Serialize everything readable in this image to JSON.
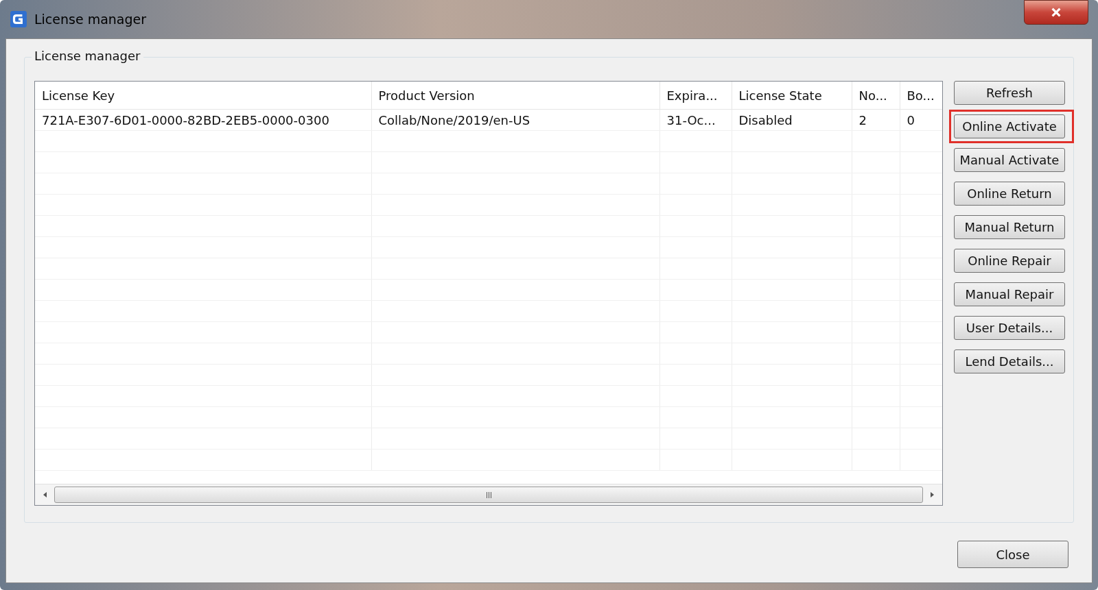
{
  "window": {
    "title": "License manager"
  },
  "group": {
    "label": "License manager"
  },
  "table": {
    "columns": [
      "License Key",
      "Product Version",
      "Expira...",
      "License State",
      "No...",
      "Bo..."
    ],
    "rows": [
      [
        "721A-E307-6D01-0000-82BD-2EB5-0000-0300",
        "Collab/None/2019/en-US",
        "31-Oc...",
        "Disabled",
        "2",
        "0"
      ]
    ]
  },
  "buttons": [
    {
      "label": "Refresh",
      "highlighted": false
    },
    {
      "label": "Online Activate",
      "highlighted": true
    },
    {
      "label": "Manual Activate",
      "highlighted": false
    },
    {
      "label": "Online Return",
      "highlighted": false
    },
    {
      "label": "Manual Return",
      "highlighted": false
    },
    {
      "label": "Online Repair",
      "highlighted": false
    },
    {
      "label": "Manual Repair",
      "highlighted": false
    },
    {
      "label": "User Details...",
      "highlighted": false
    },
    {
      "label": "Lend Details...",
      "highlighted": false
    }
  ],
  "close_button": "Close"
}
